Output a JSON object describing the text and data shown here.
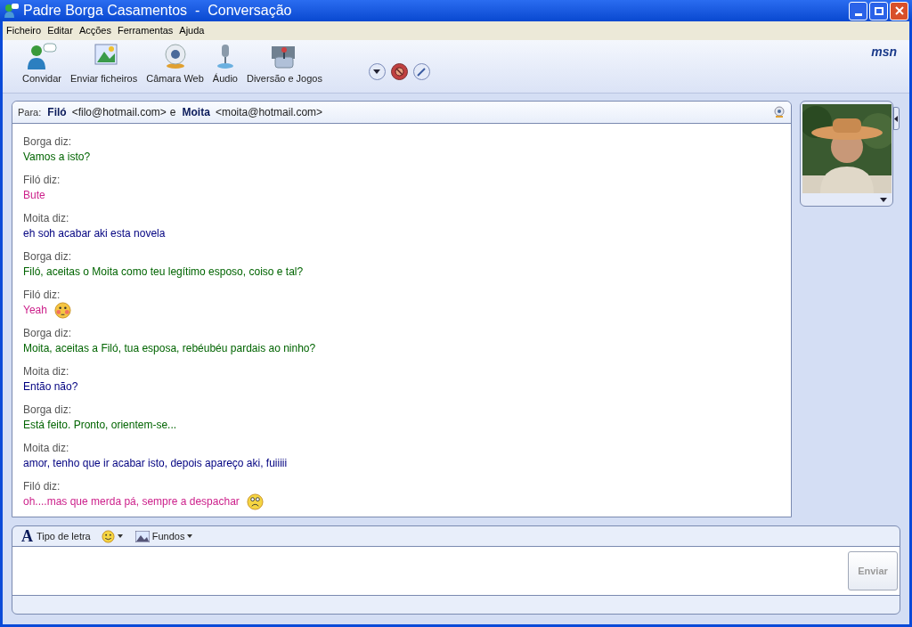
{
  "window": {
    "title": "Padre Borga Casamentos  -  Conversação"
  },
  "menu": [
    "Ficheiro",
    "Editar",
    "Acções",
    "Ferramentas",
    "Ajuda"
  ],
  "toolbar": [
    {
      "label": "Convidar",
      "kind": "invite"
    },
    {
      "label": "Enviar ficheiros",
      "kind": "files"
    },
    {
      "label": "Câmara Web",
      "kind": "webcam"
    },
    {
      "label": "Áudio",
      "kind": "audio"
    },
    {
      "label": "Diversão e Jogos",
      "kind": "games"
    }
  ],
  "logo": "msn",
  "to": {
    "label": "Para:",
    "contacts": [
      {
        "name": "Filó",
        "email": "<filo@hotmail.com>"
      },
      {
        "name": "Moita",
        "email": "<moita@hotmail.com>"
      }
    ],
    "separator": "e"
  },
  "messages": [
    {
      "sender": "Borga diz:",
      "text": "Vamos a isto?",
      "color": "#006400",
      "kind": "plain"
    },
    {
      "sender": "Filó diz:",
      "text": "Bute",
      "color": "#cc1f8a",
      "kind": "plain"
    },
    {
      "sender": "Moita diz:",
      "text": "eh soh acabar aki esta novela",
      "color": "#000080",
      "kind": "plain"
    },
    {
      "sender": "Borga diz:",
      "text": "Filó, aceitas o Moita como teu legítimo esposo, coiso e tal?",
      "color": "#006400",
      "kind": "plain"
    },
    {
      "sender": "Filó diz:",
      "text": "Yeah",
      "color": "#cc1f8a",
      "kind": "blush"
    },
    {
      "sender": "Borga diz:",
      "text": "Moita, aceitas a Filó, tua esposa, rebéubéu pardais ao ninho?",
      "color": "#006400",
      "kind": "plain"
    },
    {
      "sender": "Moita diz:",
      "text": "Então não?",
      "color": "#000080",
      "kind": "plain"
    },
    {
      "sender": "Borga diz:",
      "text": "Está feito. Pronto, orientem-se...",
      "color": "#006400",
      "kind": "plain"
    },
    {
      "sender": "Moita diz:",
      "text": "amor, tenho que ir acabar isto, depois apareço aki, fuiiiii",
      "color": "#000080",
      "kind": "plain"
    },
    {
      "sender": "Filó diz:",
      "text": "oh....mas que merda pá, sempre a despachar",
      "color": "#cc1f8a",
      "kind": "worried"
    }
  ],
  "compose": {
    "font_icon": "A",
    "font_label": "Tipo de letra",
    "backgrounds_label": "Fundos",
    "send": "Enviar",
    "send_disabled": true
  }
}
